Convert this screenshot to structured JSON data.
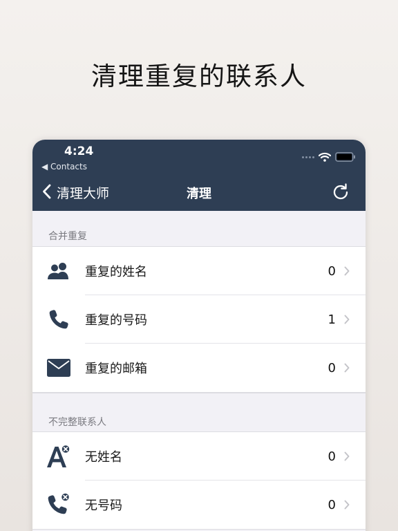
{
  "headline": "清理重复的联系人",
  "status": {
    "time": "4:24",
    "back_app": "◀ Contacts"
  },
  "nav": {
    "back_label": "清理大师",
    "title": "清理"
  },
  "sections": [
    {
      "header": "合并重复",
      "items": [
        {
          "label": "重复的姓名",
          "count": "0",
          "icon": "people-icon"
        },
        {
          "label": "重复的号码",
          "count": "1",
          "icon": "phone-icon"
        },
        {
          "label": "重复的邮箱",
          "count": "0",
          "icon": "envelope-icon"
        }
      ]
    },
    {
      "header": "不完整联系人",
      "items": [
        {
          "label": "无姓名",
          "count": "0",
          "icon": "letter-a-remove-icon"
        },
        {
          "label": "无号码",
          "count": "0",
          "icon": "phone-remove-icon"
        }
      ]
    }
  ],
  "colors": {
    "nav_bg": "#2e3e54",
    "icon": "#2e3e54",
    "background": "#f2f1f6"
  }
}
